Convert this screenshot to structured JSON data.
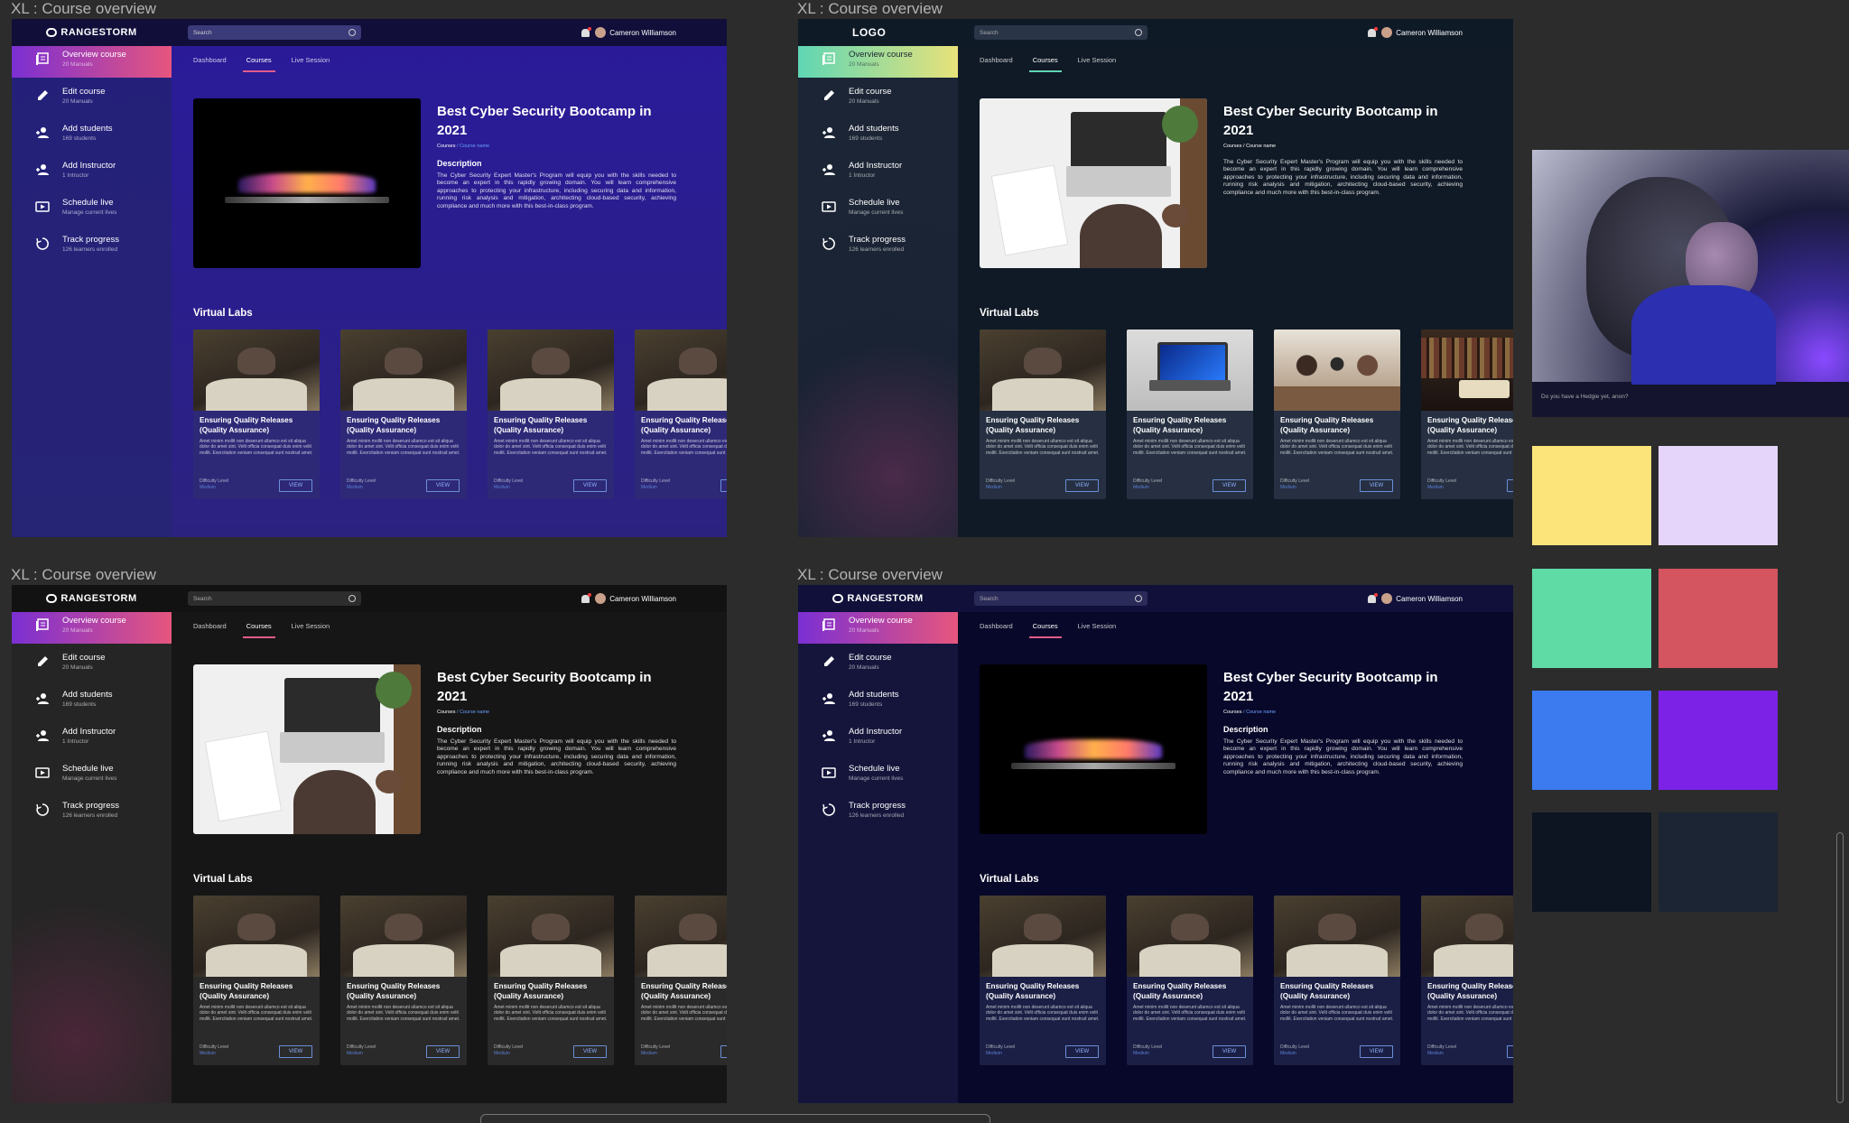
{
  "frames": [
    {
      "label": "XL : Course overview",
      "theme": "t1",
      "logo": "RANGESTORM",
      "hero_image": "img-laptop-dark",
      "description_heading": "Description",
      "description": "The Cyber Security Expert Master's Program will equip you with the skills needed to become an expert in this rapidly growing domain. You will learn comprehensive approaches to protecting your infrastructure, including securing data and information, running risk analysis and mitigation, architecting cloud-based security, achieving compliance and much more with this best-in-class program.",
      "title": "Best Cyber Security Bootcamp in 2021",
      "crumb_a": "Courses",
      "crumb_b": "/ Course name",
      "card_images": [
        "img-room",
        "img-room",
        "img-room",
        "img-room"
      ],
      "sidebar_subs": [
        "20 Manuals",
        "20 Manuals",
        "169 students",
        "1 Intructor",
        "Manage current lives",
        "126 learners enrolled"
      ]
    },
    {
      "label": "XL : Course overview",
      "theme": "t2",
      "logo": "LOGO",
      "hero_image": "img-desk",
      "description_heading": "",
      "description": "The Cyber Security Expert Master's Program will equip you with the skills needed to become an expert in this rapidly growing domain. You will learn comprehensive approaches to protecting your infrastructure, including securing data and information, running risk analysis and mitigation, architecting cloud-based security, achieving compliance and much more with this best-in-class program.",
      "title": "Best Cyber Security Bootcamp in 2021",
      "crumb_a": "Courses / Course name",
      "crumb_b": "",
      "card_images": [
        "img-room",
        "img-laptop-blue",
        "img-meeting",
        "img-library"
      ],
      "sidebar_subs": [
        "20 Manuals",
        "20 Manuals",
        "169 students",
        "1 Intructor",
        "Manage current lives",
        "126 learners enrolled"
      ]
    },
    {
      "label": "XL : Course overview",
      "theme": "t3",
      "logo": "RANGESTORM",
      "hero_image": "img-desk",
      "description_heading": "Description",
      "description": "The Cyber Security Expert Master's Program will equip you with the skills needed to become an expert in this rapidly growing domain. You will learn comprehensive approaches to protecting your infrastructure, including securing data and information, running risk analysis and mitigation, architecting cloud-based security, achieving compliance and much more with this best-in-class program.",
      "title": "Best Cyber Security Bootcamp in 2021",
      "crumb_a": "Courses",
      "crumb_b": "/ Course name",
      "card_images": [
        "img-room",
        "img-room",
        "img-room",
        "img-room"
      ],
      "sidebar_subs": [
        "20 Manuals",
        "20 Manuals",
        "169 students",
        "1 Intructor",
        "Manage current lives",
        "126 learners enrolled"
      ]
    },
    {
      "label": "XL : Course overview",
      "theme": "t4",
      "logo": "RANGESTORM",
      "hero_image": "img-laptop-dark",
      "description_heading": "Description",
      "description": "The Cyber Security Expert Master's Program will equip you with the skills needed to become an expert in this rapidly growing domain. You will learn comprehensive approaches to protecting your infrastructure, including securing data and information, running risk analysis and mitigation, architecting cloud-based security, achieving compliance and much more with this best-in-class program.",
      "title": "Best Cyber Security Bootcamp in 2021",
      "crumb_a": "Courses",
      "crumb_b": "/ Course name",
      "card_images": [
        "img-room",
        "img-room",
        "img-room",
        "img-room"
      ],
      "sidebar_subs": [
        "20 Manuals",
        "20 Manuals",
        "169 students",
        "1 Intructor",
        "Manage current lives",
        "126 learners enrolled"
      ]
    }
  ],
  "sidebar_items": [
    {
      "title": "Overview course",
      "icon": "book-icon"
    },
    {
      "title": "Edit course",
      "icon": "pencil-icon"
    },
    {
      "title": "Add students",
      "icon": "add-user-icon"
    },
    {
      "title": "Add Instructor",
      "icon": "add-user-icon"
    },
    {
      "title": "Schedule live",
      "icon": "play-screen-icon"
    },
    {
      "title": "Track progress",
      "icon": "progress-icon"
    }
  ],
  "search_placeholder": "Search",
  "user_name": "Cameron Williamson",
  "tabs": [
    "Dashboard",
    "Courses",
    "Live Session"
  ],
  "labs_title": "Virtual Labs",
  "card": {
    "title": "Ensuring Quality Releases (Quality Assurance)",
    "text": "Amet minim mollit non deserunt ullamco est sit aliqua dolor do amet sint. Velit officia consequat duis enim velit mollit. Exercitation veniam consequat sunt nostrud amet.",
    "difficulty_label": "Difficulty Level",
    "difficulty_value": "Medium",
    "button": "VIEW"
  },
  "hedgehog_caption": "Do you have a Hedgie yet, anon?",
  "swatches": [
    "#fde47a",
    "#e6d5fb",
    "#5fdba6",
    "#d4545f",
    "#3b7bef",
    "#7c22e6",
    "#0d1422",
    "#1c2534"
  ]
}
